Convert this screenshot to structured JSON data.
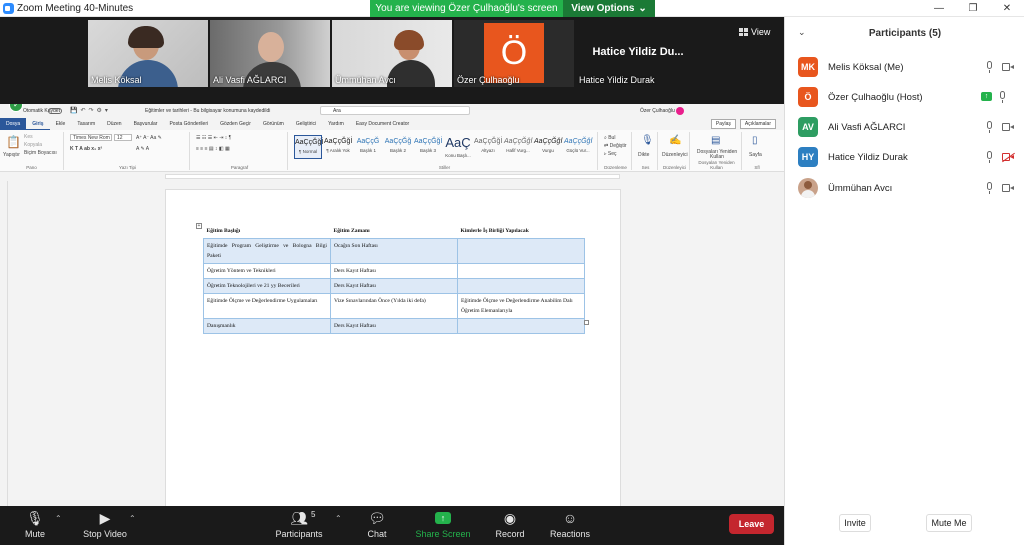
{
  "window": {
    "title": "Zoom Meeting 40-Minutes"
  },
  "share_banner": {
    "viewing": "You are viewing Özer Çulhaoğlu's screen",
    "options": "View Options"
  },
  "view_button": {
    "label": "View"
  },
  "video_tiles": [
    {
      "name": "Melis Köksal"
    },
    {
      "name": "Ali Vasfi AĞLARCI"
    },
    {
      "name": "Ümmühan Avcı"
    },
    {
      "name": "Özer Çulhaoğlu",
      "letter": "Ö"
    },
    {
      "name": "Hatice Yildiz Durak",
      "big_name": "Hatice Yildiz Du..."
    }
  ],
  "word": {
    "autosave": "Otomatik Kaydet",
    "doc_title": "Eğitimler ve tarihleri  -  Bu bilgisayar konumuna kaydedildi",
    "search_placeholder": "Ara",
    "user": "Özer Çulhaoğlu",
    "tabs": [
      "Dosya",
      "Giriş",
      "Ekle",
      "Tasarım",
      "Düzen",
      "Başvurular",
      "Posta Gönderileri",
      "Gözden Geçir",
      "Görünüm",
      "Geliştirici",
      "Yardım",
      "Easy Document Creator"
    ],
    "right_buttons": {
      "share": "Paylaş",
      "comments": "Açıklamalar"
    },
    "clipboard": {
      "paste": "Yapıştır",
      "cut": "Kes",
      "copy": "Kopyala",
      "format": "Biçim Boyacısı",
      "group": "Pano"
    },
    "font": {
      "name": "Times New Rom",
      "size": "12",
      "group": "Yazı Tipi"
    },
    "paragraph_group": "Paragraf",
    "styles": [
      {
        "sample": "AaÇçĞğİ",
        "name": "¶ Normal"
      },
      {
        "sample": "AaÇçĞğİ",
        "name": "¶ Aralık Yok"
      },
      {
        "sample": "AaÇçĞ",
        "name": "Başlık 1"
      },
      {
        "sample": "AaÇçĞğ",
        "name": "Başlık 2"
      },
      {
        "sample": "AaÇçĞğİ",
        "name": "Başlık 3"
      },
      {
        "sample": "AaÇ",
        "name": "Konu Başlı..."
      },
      {
        "sample": "AaÇçĞğİ",
        "name": "Altyazı"
      },
      {
        "sample": "AaÇçĞğİ",
        "name": "Hafif Vurg..."
      },
      {
        "sample": "AaÇçĞğİ",
        "name": "Vurgu"
      },
      {
        "sample": "AaÇçĞğİ",
        "name": "Güçlü Vur..."
      }
    ],
    "styles_group": "Stiller",
    "editing": {
      "find": "Bul",
      "replace": "Değiştir",
      "select": "Seç",
      "group": "Düzenleme"
    },
    "dictate": {
      "label": "Dikte",
      "group": "Ses"
    },
    "editor": {
      "label": "Düzenleyici",
      "group": "Düzenleyici"
    },
    "reuse": {
      "label": "Dosyaları Yeniden Kullan",
      "group": "Dosyaları Yeniden Kullan"
    },
    "page_btn": {
      "label": "Sayfa",
      "group": "Sfl"
    },
    "table": {
      "headers": [
        "Eğitim Başlığı",
        "Eğitim Zamanı",
        "Kimlerle İş Birliği Yapılacak"
      ],
      "rows": [
        [
          "Eğitimde Program Geliştirme ve Bologna Bilgi Paketi",
          "Ocağın Son Haftası",
          ""
        ],
        [
          "Öğretim Yöntem ve Teknikleri",
          "Ders Kayıt Haftası",
          ""
        ],
        [
          "Öğretim Teknolojileri ve 21 yy Becerileri",
          "Ders Kayıt Haftası",
          ""
        ],
        [
          "Eğitimde Ölçme ve Değerlendirme Uygulamaları",
          "Vize Sınavlarından Önce (Yılda iki defa)",
          "Eğitimde Ölçme ve Değerlendirme Anabilim Dalı Öğretim Elemanlarıyla"
        ],
        [
          "Danışmanlık",
          "Ders Kayıt Haftası",
          ""
        ]
      ]
    }
  },
  "toolbar": {
    "mute": "Mute",
    "stop_video": "Stop Video",
    "participants": "Participants",
    "participants_count": "5",
    "chat": "Chat",
    "share_screen": "Share Screen",
    "record": "Record",
    "reactions": "Reactions",
    "leave": "Leave"
  },
  "panel": {
    "title": "Participants (5)",
    "participants": [
      {
        "initials": "MK",
        "name": "Melis Köksal (Me)",
        "color": "#e8561e"
      },
      {
        "initials": "Ö",
        "name": "Özer Çulhaoğlu (Host)",
        "color": "#e8561e"
      },
      {
        "initials": "AV",
        "name": "Ali Vasfi AĞLARCI",
        "color": "#2e9d62"
      },
      {
        "initials": "HY",
        "name": "Hatice Yildiz Durak",
        "color": "#2d7fc1"
      },
      {
        "initials": "",
        "name": "Ümmühan Avcı",
        "color": "#c9a28a"
      }
    ],
    "invite": "Invite",
    "mute_me": "Mute Me"
  }
}
